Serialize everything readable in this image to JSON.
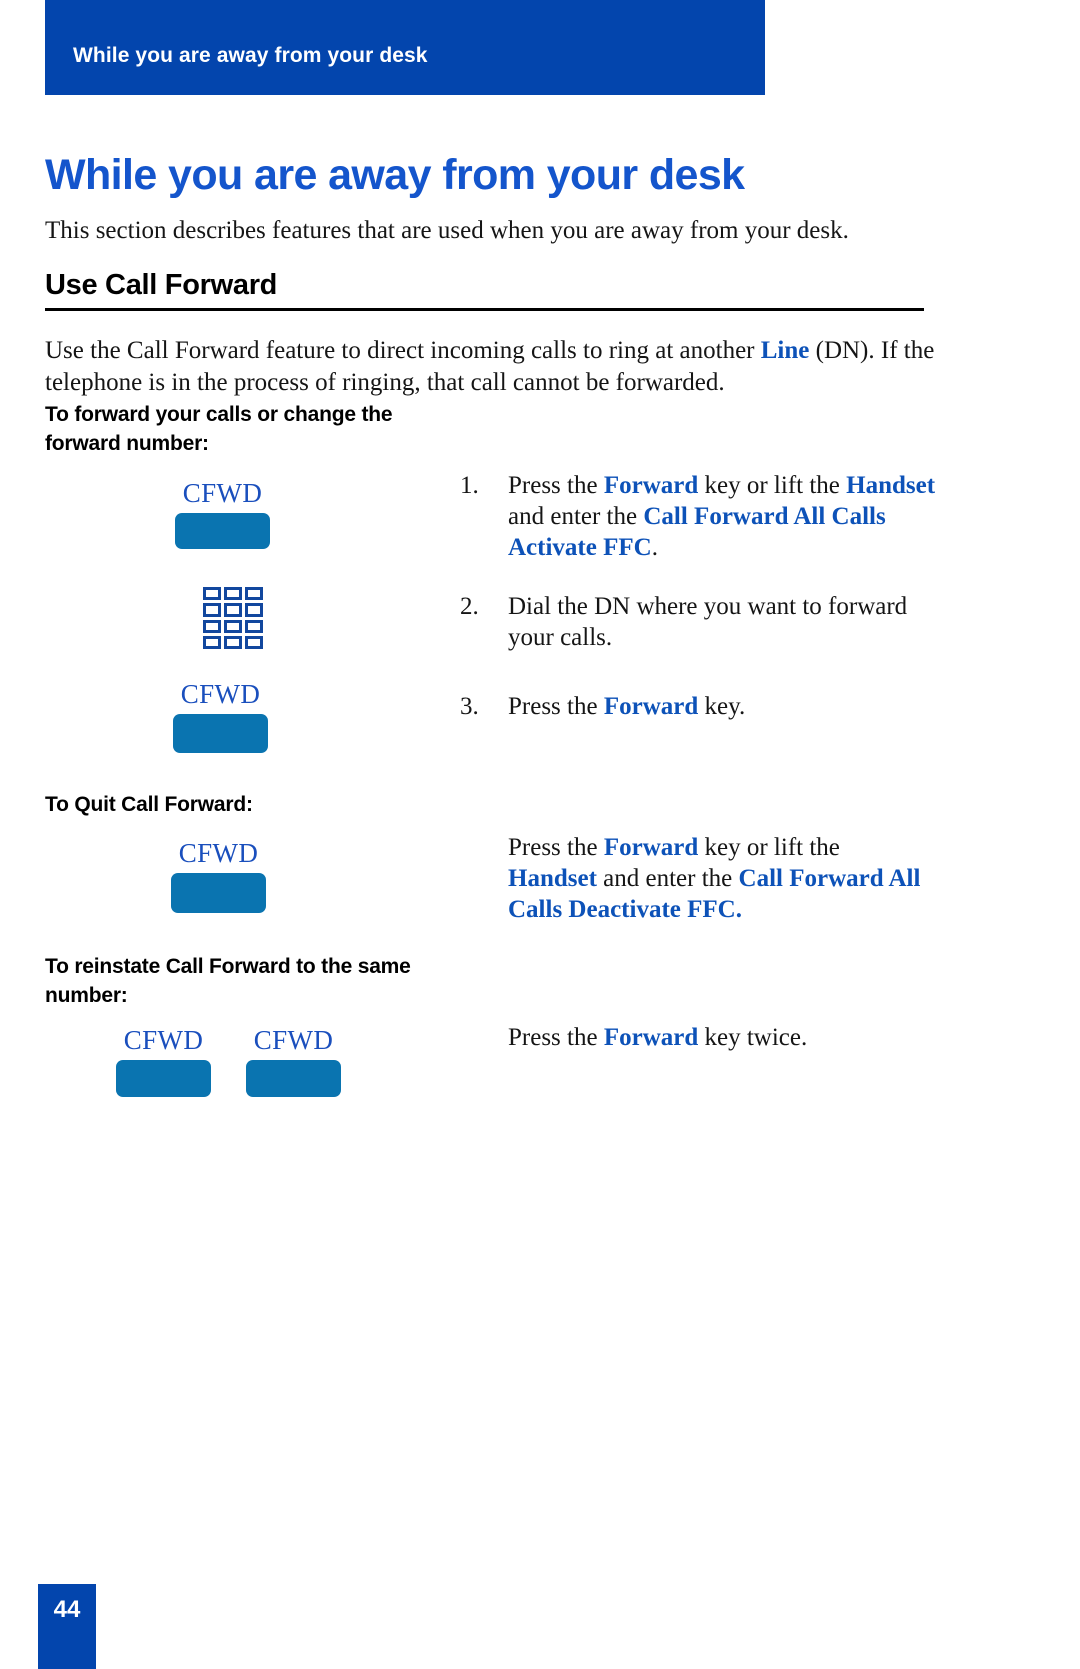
{
  "header": {
    "running_title": "While you are away from your desk",
    "bar_color": "#0345ad"
  },
  "page": {
    "chapter_title": "While you are away from your desk",
    "intro": "This section describes features that are used when you are away from your desk.",
    "section_heading": "Use Call Forward",
    "body_paragraph": {
      "part1": "Use the Call Forward feature to direct incoming calls to ring at another ",
      "emphasis1": "Line",
      "part2": " (DN). If the telephone is in the process of ringing, that call cannot be forwarded."
    },
    "page_number": "44"
  },
  "procedures": [
    {
      "sub_head": "To forward your calls or change the forward number:",
      "steps": [
        {
          "number": "1.",
          "text_part1": "Press the ",
          "em1": "Forward",
          "text_part2": " key or lift the ",
          "em2": "Handset",
          "text_part3": " and enter the ",
          "em3": "Call Forward All Calls Activate FFC",
          "text_part4": "."
        },
        {
          "number": "2.",
          "text_part1": "Dial the DN where you want to forward your calls.",
          "em1": "",
          "text_part2": "",
          "em2": "",
          "text_part3": "",
          "em3": "",
          "text_part4": ""
        },
        {
          "number": "3.",
          "text_part1": "Press the ",
          "em1": "Forward",
          "text_part2": " key.",
          "em2": "",
          "text_part3": "",
          "em3": "",
          "text_part4": ""
        }
      ]
    },
    {
      "sub_head": "To Quit Call Forward:",
      "instruction": {
        "text_part1": "Press the ",
        "em1": "Forward",
        "text_part2": " key or lift the ",
        "em2": "Handset",
        "text_part3": " and enter the ",
        "em3": "Call Forward All Calls Deactivate FFC."
      }
    },
    {
      "sub_head": "To reinstate Call Forward to the same number:",
      "instruction": {
        "text_part1": "Press the ",
        "em1": "Forward",
        "text_part2": " key twice.",
        "em2": "",
        "text_part3": ""
      }
    }
  ],
  "keys": {
    "cfwd_label": "CFWD",
    "key_color": "#0a74b0",
    "label_color": "#1a4fbd",
    "dialpad_icon_name": "dialpad-icon"
  },
  "colors": {
    "brand_blue": "#0345ad",
    "title_blue": "#1455cc",
    "emphasis_blue": "#0d52b8",
    "key_blue": "#0a74b0"
  }
}
